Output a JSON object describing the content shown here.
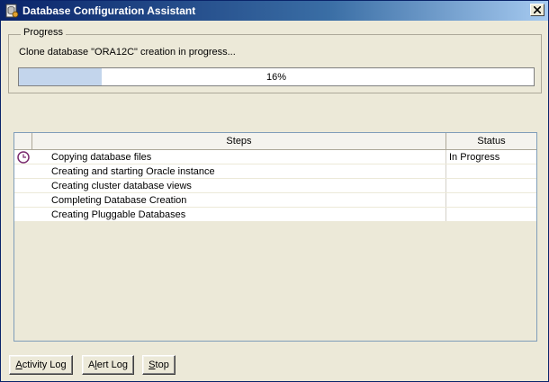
{
  "window": {
    "title": "Database Configuration Assistant",
    "icon": "dbca-app-icon",
    "close_icon": "close-icon"
  },
  "progress": {
    "legend": "Progress",
    "message": "Clone database \"ORA12C\" creation in progress...",
    "percent_label": "16%",
    "percent": 16
  },
  "steps": {
    "header_steps": "Steps",
    "header_status": "Status",
    "rows": [
      {
        "label": "Copying database files",
        "status": "In Progress",
        "icon": "clock-icon"
      },
      {
        "label": "Creating and starting Oracle instance",
        "status": ""
      },
      {
        "label": "Creating cluster database views",
        "status": ""
      },
      {
        "label": "Completing Database Creation",
        "status": ""
      },
      {
        "label": "Creating Pluggable Databases",
        "status": ""
      }
    ]
  },
  "buttons": {
    "activity_log": {
      "prefix": "",
      "mnemonic": "A",
      "rest": "ctivity Log"
    },
    "alert_log": {
      "prefix": "A",
      "mnemonic": "l",
      "rest": "ert Log"
    },
    "stop": {
      "prefix": "",
      "mnemonic": "S",
      "rest": "top"
    }
  },
  "colors": {
    "title_start": "#0a246a",
    "progress_fill": "#c3d5ec",
    "window_bg": "#ece9d8"
  }
}
